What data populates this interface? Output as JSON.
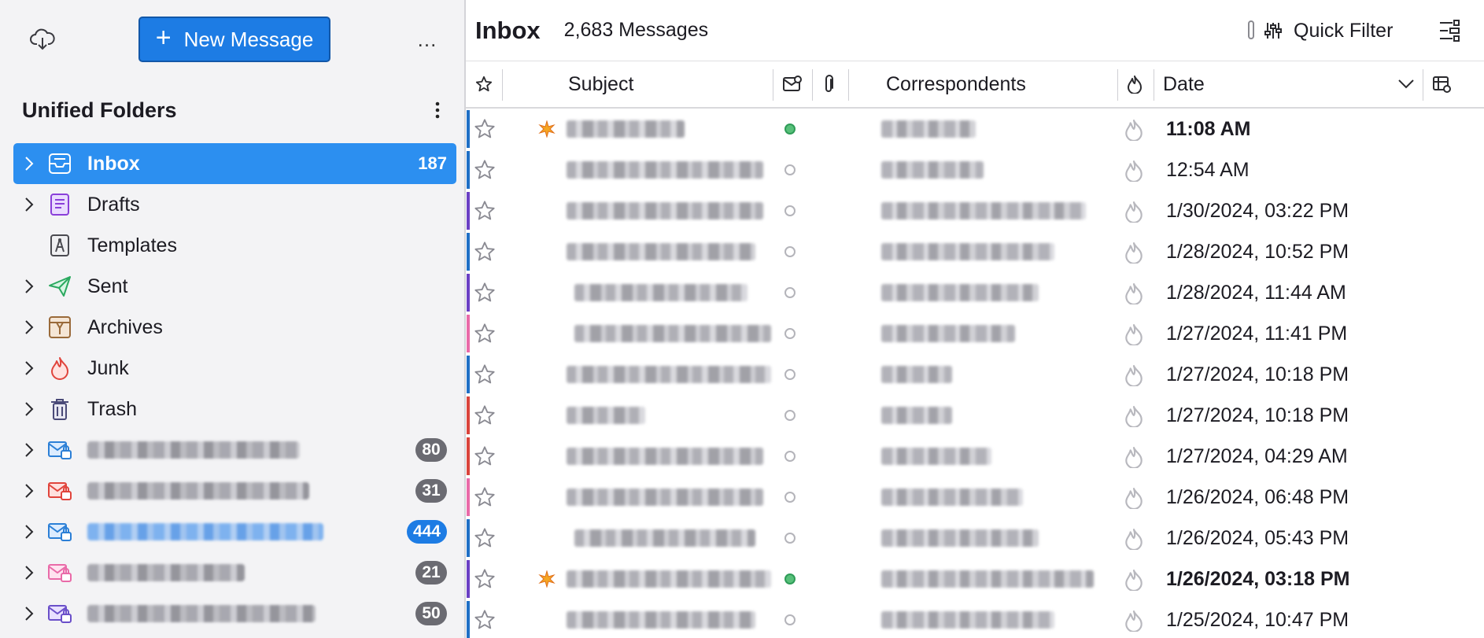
{
  "folder_pane": {
    "new_message_label": "New Message",
    "more_label": "...",
    "unified_title": "Unified Folders",
    "folders": [
      {
        "name": "Inbox",
        "count": "187",
        "icon": "inbox-icon",
        "selected": true
      },
      {
        "name": "Drafts",
        "icon": "drafts-icon"
      },
      {
        "name": "Templates",
        "icon": "templates-icon"
      },
      {
        "name": "Sent",
        "icon": "sent-icon"
      },
      {
        "name": "Archives",
        "icon": "archives-icon"
      },
      {
        "name": "Junk",
        "icon": "junk-icon"
      },
      {
        "name": "Trash",
        "icon": "trash-icon"
      }
    ],
    "accounts": [
      {
        "count": "80",
        "icon_color": "#2b7fd6"
      },
      {
        "count": "31",
        "icon_color": "#e0443c"
      },
      {
        "count": "444",
        "icon_color": "#2b7fd6",
        "highlight": true
      },
      {
        "count": "21",
        "icon_color": "#e96aa8"
      },
      {
        "count": "50",
        "icon_color": "#6a4fc9"
      }
    ]
  },
  "thread_pane": {
    "title": "Inbox",
    "message_count": "2,683 Messages",
    "quick_filter_label": "Quick Filter",
    "columns": {
      "subject": "Subject",
      "correspondents": "Correspondents",
      "date": "Date"
    },
    "messages": [
      {
        "date": "11:08 AM",
        "unread": true,
        "tag_color": "#1f6fc5",
        "new": true
      },
      {
        "date": "12:54 AM",
        "unread": false,
        "tag_color": "#1f6fc5",
        "new": false
      },
      {
        "date": "1/30/2024, 03:22 PM",
        "unread": false,
        "tag_color": "#6a3fc4",
        "new": false
      },
      {
        "date": "1/28/2024, 10:52 PM",
        "unread": false,
        "tag_color": "#1f6fc5",
        "new": false
      },
      {
        "date": "1/28/2024, 11:44 AM",
        "unread": false,
        "tag_color": "#6a3fc4",
        "new": false
      },
      {
        "date": "1/27/2024, 11:41 PM",
        "unread": false,
        "tag_color": "#e96aa8",
        "new": false
      },
      {
        "date": "1/27/2024, 10:18 PM",
        "unread": false,
        "tag_color": "#1f6fc5",
        "new": false
      },
      {
        "date": "1/27/2024, 10:18 PM",
        "unread": false,
        "tag_color": "#d9433b",
        "new": false
      },
      {
        "date": "1/27/2024, 04:29 AM",
        "unread": false,
        "tag_color": "#d9433b",
        "new": false
      },
      {
        "date": "1/26/2024, 06:48 PM",
        "unread": false,
        "tag_color": "#e96aa8",
        "new": false
      },
      {
        "date": "1/26/2024, 05:43 PM",
        "unread": false,
        "tag_color": "#1f6fc5",
        "new": false
      },
      {
        "date": "1/26/2024, 03:18 PM",
        "unread": true,
        "tag_color": "#6a3fc4",
        "new": true
      },
      {
        "date": "1/25/2024, 10:47 PM",
        "unread": false,
        "tag_color": "#1f6fc5",
        "new": false
      }
    ]
  }
}
